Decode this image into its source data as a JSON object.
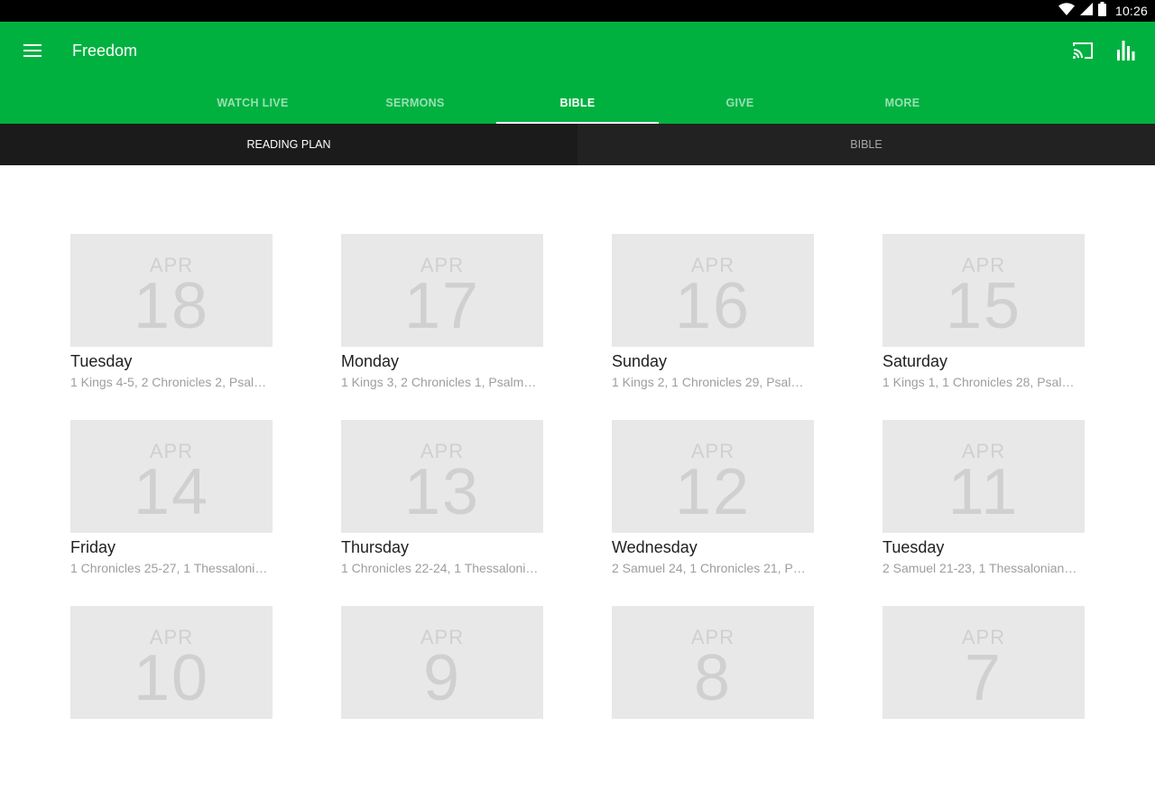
{
  "status_bar": {
    "time": "10:26",
    "icons": [
      "wifi-icon",
      "cell-signal-icon",
      "battery-icon"
    ]
  },
  "app_bar": {
    "title": "Freedom",
    "menu_icon": "hamburger-menu-icon",
    "actions": [
      "cast-icon",
      "stats-chart-icon"
    ],
    "color": "#00b140"
  },
  "tabs": [
    {
      "label": "WATCH LIVE",
      "active": false
    },
    {
      "label": "SERMONS",
      "active": false
    },
    {
      "label": "BIBLE",
      "active": true
    },
    {
      "label": "GIVE",
      "active": false
    },
    {
      "label": "MORE",
      "active": false
    }
  ],
  "subtabs": [
    {
      "label": "READING PLAN",
      "active": true
    },
    {
      "label": "BIBLE",
      "active": false
    }
  ],
  "reading_plan": [
    {
      "month": "APR",
      "day": "18",
      "weekday": "Tuesday",
      "readings": "1 Kings 4-5, 2 Chronicles 2, Psal…"
    },
    {
      "month": "APR",
      "day": "17",
      "weekday": "Monday",
      "readings": "1 Kings 3, 2 Chronicles 1, Psalm…"
    },
    {
      "month": "APR",
      "day": "16",
      "weekday": "Sunday",
      "readings": "1 Kings 2, 1 Chronicles 29, Psal…"
    },
    {
      "month": "APR",
      "day": "15",
      "weekday": "Saturday",
      "readings": "1 Kings 1, 1 Chronicles 28, Psal…"
    },
    {
      "month": "APR",
      "day": "14",
      "weekday": "Friday",
      "readings": "1 Chronicles 25-27, 1 Thessaloni…"
    },
    {
      "month": "APR",
      "day": "13",
      "weekday": "Thursday",
      "readings": "1 Chronicles 22-24, 1 Thessaloni…"
    },
    {
      "month": "APR",
      "day": "12",
      "weekday": "Wednesday",
      "readings": "2 Samuel 24, 1 Chronicles 21, P…"
    },
    {
      "month": "APR",
      "day": "11",
      "weekday": "Tuesday",
      "readings": "2 Samuel 21-23, 1 Thessalonian…"
    },
    {
      "month": "APR",
      "day": "10",
      "weekday": "",
      "readings": ""
    },
    {
      "month": "APR",
      "day": "9",
      "weekday": "",
      "readings": ""
    },
    {
      "month": "APR",
      "day": "8",
      "weekday": "",
      "readings": ""
    },
    {
      "month": "APR",
      "day": "7",
      "weekday": "",
      "readings": ""
    }
  ]
}
